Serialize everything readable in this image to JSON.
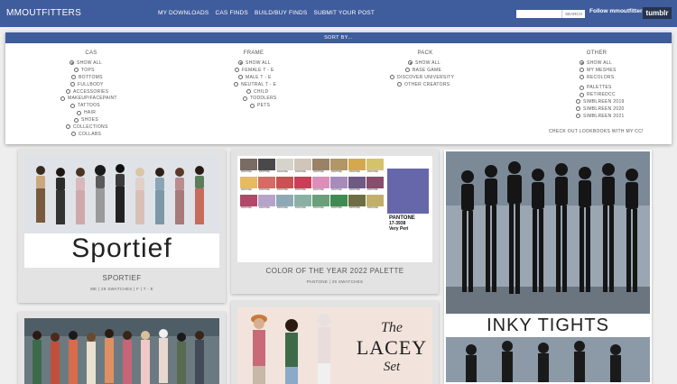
{
  "header": {
    "logo": "MMOUTFITTERS",
    "nav": [
      "MY DOWNLOADS",
      "CAS FINDS",
      "BUILD/BUY FINDS",
      "SUBMIT YOUR POST"
    ],
    "search_button": "SEARCH",
    "follow": "Follow mmoutfitters",
    "tumblr": "tumblr"
  },
  "sort": {
    "header": "SORT BY...",
    "columns": [
      {
        "title": "CAS",
        "options": [
          "SHOW ALL",
          "TOPS",
          "BOTTOMS",
          "FULLBODY",
          "ACCESSORIES",
          "MAKEUP/FACEPAINT",
          "TATTOOS",
          "HAIR",
          "SHOES",
          "COLLECTIONS",
          "COLLABS"
        ]
      },
      {
        "title": "FRAME",
        "options": [
          "SHOW ALL",
          "FEMALE T - E",
          "MALE T - E",
          "NEUTRAL T - E",
          "CHILD",
          "TODDLERS",
          "PETS"
        ]
      },
      {
        "title": "PACK",
        "options": [
          "SHOW ALL",
          "BASE GAME",
          "DISCOVER UNIVERSITY",
          "OTHER CREATORS"
        ]
      },
      {
        "title": "OTHER",
        "options": [
          "SHOW ALL",
          "MY MESHES",
          "RECOLORS",
          "PALETTES",
          "RETIREDCC",
          "SIMBLREEN 2019",
          "SIMBLREEN 2020",
          "SIMBLREEN 2021"
        ]
      }
    ],
    "lookbooks": "CHECK OUT LOOKBOOKS WITH MY CC!"
  },
  "cards": {
    "sportief": {
      "overlay": "Sportief",
      "title": "SPORTIEF",
      "subtitle": "ME | 29 SWATCHES | F | T - E"
    },
    "palette": {
      "title": "COLOR OF THE YEAR 2022 PALETTE",
      "subtitle": "PANTONE | 29 SWATCHES",
      "swatch_label": "PANTONE",
      "big_label": "PANTONE",
      "big_code": "17-3938",
      "big_name": "Very Peri"
    },
    "inky": {
      "overlay": "INKY TIGHTS"
    },
    "lacey": {
      "overlay_the": "The",
      "overlay_lacey": "LACEY",
      "overlay_set": "Set"
    }
  },
  "colors": {
    "brand": "#3f5c9c",
    "very_peri": "#6667ab",
    "swatches": [
      "#7a6c63",
      "#4a4848",
      "#d8d2cc",
      "#cfc5b9",
      "#9a8266",
      "#b19766",
      "#d4a94e",
      "#d4c36a",
      "#e6bb63",
      "#d36c63",
      "#c85252",
      "#c83f57",
      "#da8fba",
      "#a88bba",
      "#6f5a86",
      "#8a4c6b",
      "#b4486a",
      "#b6a3ca",
      "#8fa9b4",
      "#8ab0a6",
      "#6aa07a",
      "#3f8b53",
      "#6e6e45",
      "#c2b069"
    ]
  }
}
